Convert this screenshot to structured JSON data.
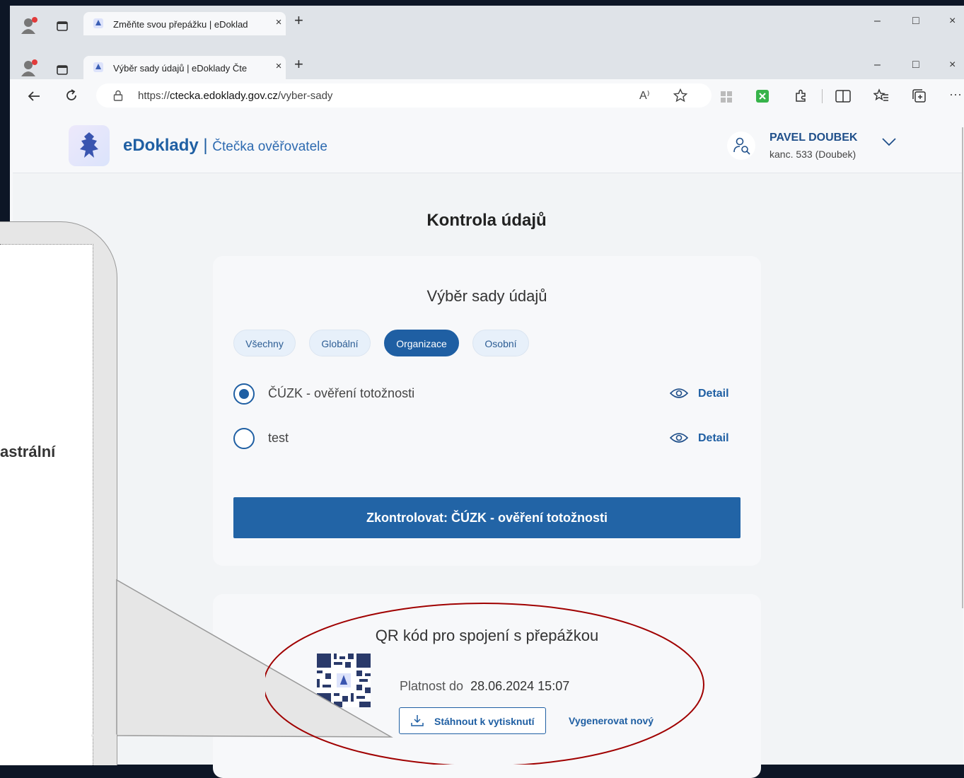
{
  "back_window": {
    "tab_title": "Změňte svou přepážku | eDoklad",
    "tab_close": "×",
    "new_tab": "+",
    "controls": {
      "minimize": "–",
      "maximize": "□",
      "close": "×"
    }
  },
  "front_window": {
    "tab_title": "Výběr sady údajů | eDoklady Čte",
    "tab_close": "×",
    "new_tab": "+",
    "controls": {
      "minimize": "–",
      "maximize": "□",
      "close": "×"
    },
    "url_prefix": "https://",
    "url_domain": "ctecka.edoklady.gov.cz",
    "url_path": "/vyber-sady",
    "read_aloud": "A⁾",
    "more": "···"
  },
  "header": {
    "brand": "eDoklady",
    "separator": "|",
    "subtitle": "Čtečka ověřovatele",
    "user_name": "PAVEL DOUBEK",
    "user_office": "kanc. 533 (Doubek)"
  },
  "main": {
    "page_title": "Kontrola údajů",
    "selection": {
      "title": "Výběr sady údajů",
      "filters": [
        {
          "label": "Všechny",
          "active": false
        },
        {
          "label": "Globální",
          "active": false
        },
        {
          "label": "Organizace",
          "active": true
        },
        {
          "label": "Osobní",
          "active": false
        }
      ],
      "options": [
        {
          "label": "ČÚZK - ověření totožnosti",
          "selected": true,
          "detail": "Detail"
        },
        {
          "label": "test",
          "selected": false,
          "detail": "Detail"
        }
      ],
      "submit_label": "Zkontrolovat: ČÚZK - ověření totožnosti"
    },
    "qr": {
      "title": "QR kód pro spojení s přepážkou",
      "valid_label": "Platnost do",
      "valid_value": "28.06.2024 15:07",
      "download_label": "Stáhnout k vytisknutí",
      "regenerate_label": "Vygenerovat nový"
    }
  },
  "callout": {
    "text_fragment": "astrální"
  },
  "colors": {
    "primary": "#1f5fa3",
    "button": "#2264a6",
    "highlight_ellipse": "#a00000",
    "desktop": "#0d1626"
  }
}
